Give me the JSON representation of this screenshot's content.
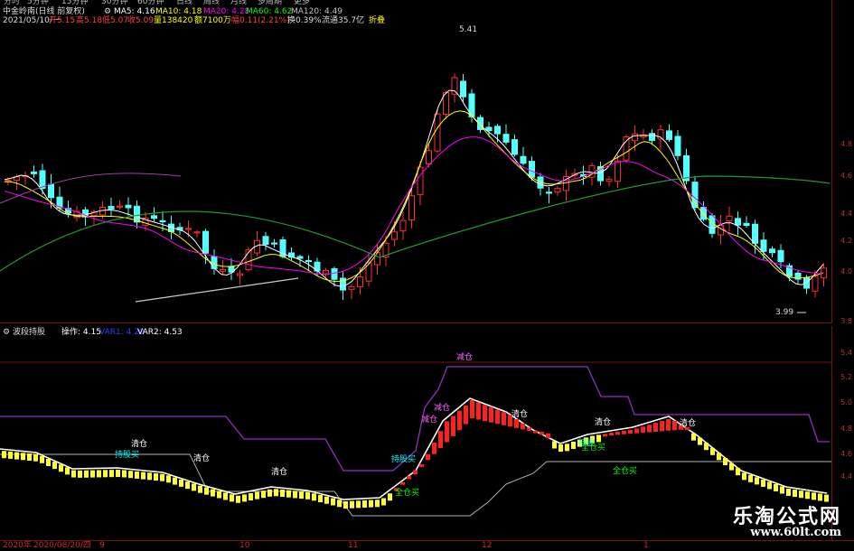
{
  "top_bar": {
    "menu_items": [
      "分时",
      "5分钟",
      "15分钟",
      "30分钟",
      "60分钟",
      "日线",
      "周线",
      "月线",
      "多周期",
      "更多"
    ],
    "stock_title": "中金岭南(日线 前复权)",
    "ma_legend": [
      {
        "label": "MA5: 4.16",
        "color": "#ffffff"
      },
      {
        "label": "MA10: 4.18",
        "color": "#ffff00"
      },
      {
        "label": "MA20: 4.28",
        "color": "#ff00ff"
      },
      {
        "label": "MA60: 4.62",
        "color": "#00ff00"
      },
      {
        "label": "MA120: 4.49",
        "color": "#c0c0c0"
      }
    ],
    "quote_line": {
      "date": "2021/05/10/一",
      "open": "开5.15",
      "high": "高5.18",
      "low": "低5.07",
      "close": "收5.09",
      "volume": "量138420",
      "amount": "额7100万",
      "change": "幅0.11(2.21%)",
      "turnover": "换0.39%",
      "float": "流通35.7亿",
      "fold": "折叠"
    }
  },
  "price_annotations": {
    "high": "5.41",
    "low": "3.99"
  },
  "price_axis": [
    "4.8",
    "4.6",
    "4.4",
    "4.2",
    "4.0",
    "3.8"
  ],
  "indicator": {
    "name": "波段持股",
    "legend": [
      {
        "label": "操作: 4.15",
        "color": "#ffffff"
      },
      {
        "label": "VAR1: 4.20",
        "color": "#3040ff"
      },
      {
        "label": "VAR2: 4.53",
        "color": "#ffffff"
      }
    ],
    "axis": [
      "5.4",
      "5.2",
      "5.0",
      "4.8",
      "4.6",
      "4.4"
    ],
    "signals": [
      {
        "text": "持股买",
        "color": "#00ffff"
      },
      {
        "text": "清仓",
        "color": "#ffffff"
      },
      {
        "text": "清仓",
        "color": "#ffffff"
      },
      {
        "text": "清仓",
        "color": "#ffffff"
      },
      {
        "text": "持股买",
        "color": "#00ffff"
      },
      {
        "text": "全仓买",
        "color": "#00ff00"
      },
      {
        "text": "减仓",
        "color": "#ff66ff"
      },
      {
        "text": "减仓",
        "color": "#ff66ff"
      },
      {
        "text": "减仓",
        "color": "#ff66ff"
      },
      {
        "text": "清仓",
        "color": "#ffffff"
      },
      {
        "text": "持股",
        "color": "#00ffff"
      },
      {
        "text": "全仓买",
        "color": "#00ff00"
      },
      {
        "text": "清仓",
        "color": "#ffffff"
      },
      {
        "text": "全仓买",
        "color": "#00ff00"
      },
      {
        "text": "清仓",
        "color": "#ffffff"
      }
    ]
  },
  "time_axis": {
    "labels": [
      "2020年",
      "2020/08/20/四",
      "9",
      "10",
      "11",
      "12",
      "1"
    ]
  },
  "watermark": {
    "title": "乐淘公式网",
    "url": "www.60lt.com"
  }
}
